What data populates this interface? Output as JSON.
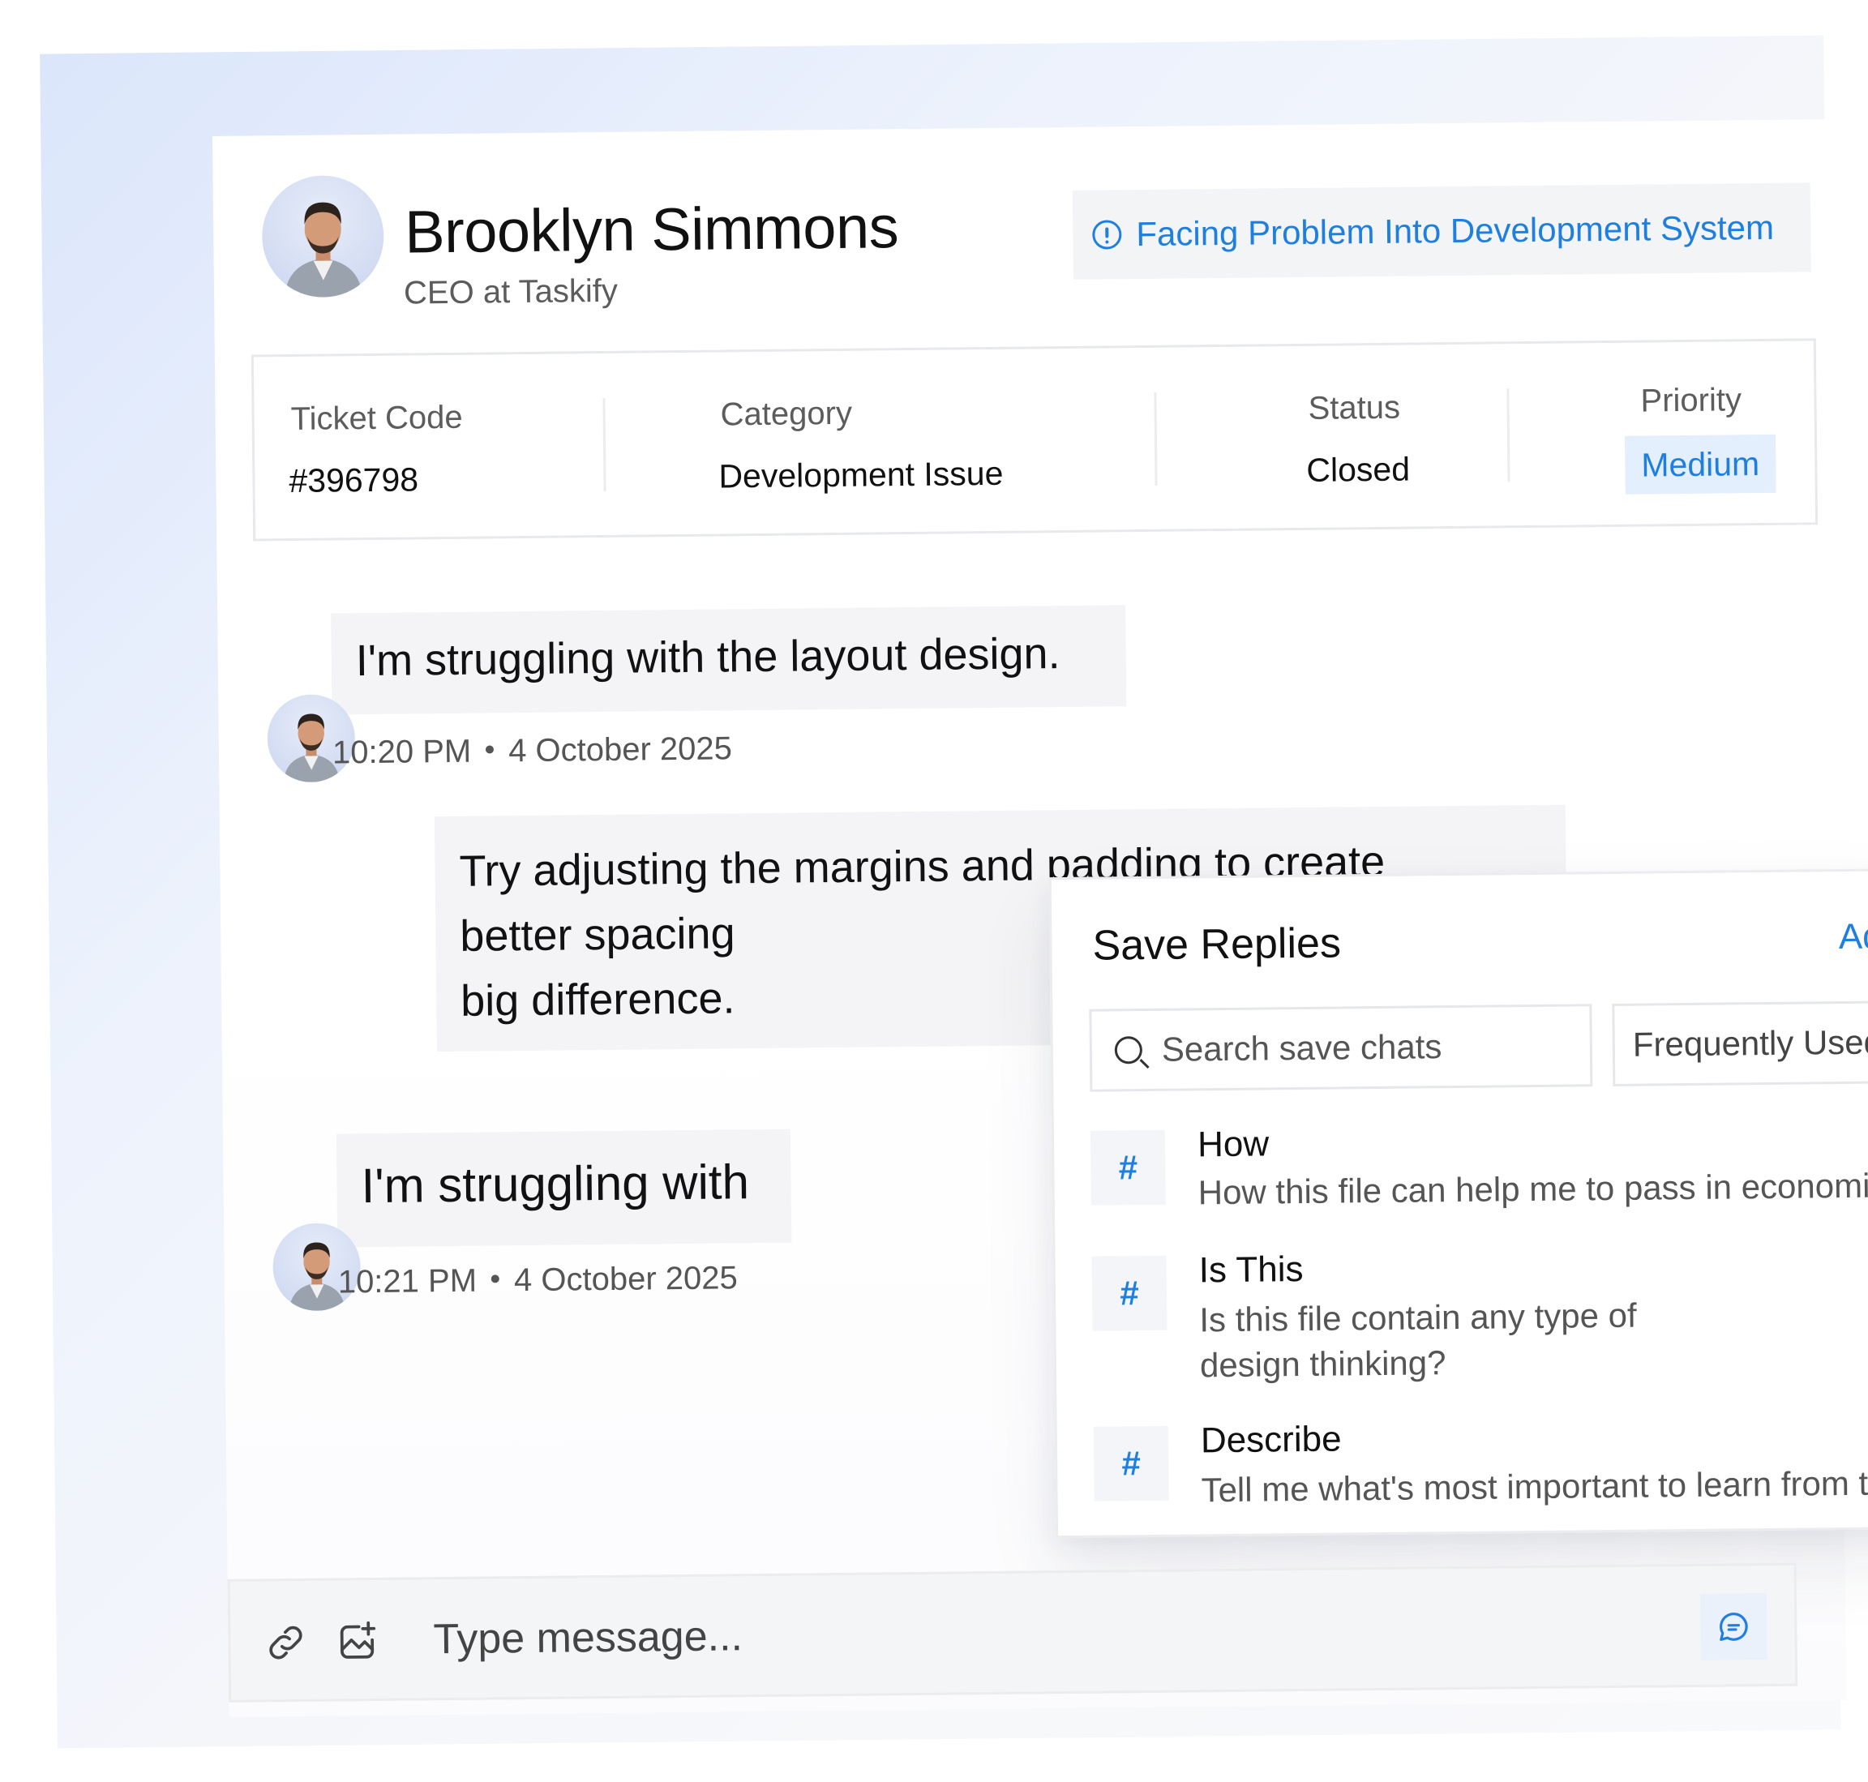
{
  "profile": {
    "name": "Brooklyn Simmons",
    "role": "CEO at Taskify"
  },
  "subject": {
    "icon": "info-circle-icon",
    "text": "Facing Problem Into Development System"
  },
  "ticket": {
    "code_label": "Ticket Code",
    "code_value": "#396798",
    "category_label": "Category",
    "category_value": "Development Issue",
    "status_label": "Status",
    "status_value": "Closed",
    "priority_label": "Priority",
    "priority_value": "Medium"
  },
  "messages": [
    {
      "text": "I'm struggling with the layout design.",
      "time": "10:20 PM",
      "date": "4 October 2025"
    },
    {
      "lines": [
        "Try adjusting the margins and padding to create",
        "better spacing",
        "big difference."
      ]
    },
    {
      "text": "I'm struggling with",
      "time": "10:21 PM",
      "date": "4 October 2025"
    }
  ],
  "saved_replies": {
    "title": "Save Replies",
    "add_label": "Add New",
    "search_placeholder": "Search save chats",
    "filter_value": "Frequently Used",
    "items": [
      {
        "hash": "#",
        "title": "How",
        "body_lines": [
          "How this file can help me to pass in economics?"
        ]
      },
      {
        "hash": "#",
        "title": "Is This",
        "body_lines": [
          "Is this file contain any type of",
          "design thinking?"
        ]
      },
      {
        "hash": "#",
        "title": "Describe",
        "body_lines": [
          "Tell me what's most important to learn from this file."
        ]
      }
    ]
  },
  "composer": {
    "placeholder": "Type message..."
  },
  "colors": {
    "accent": "#1e7fe0",
    "badge_bg": "#e4effd",
    "bubble_bg": "#f4f4f6"
  }
}
